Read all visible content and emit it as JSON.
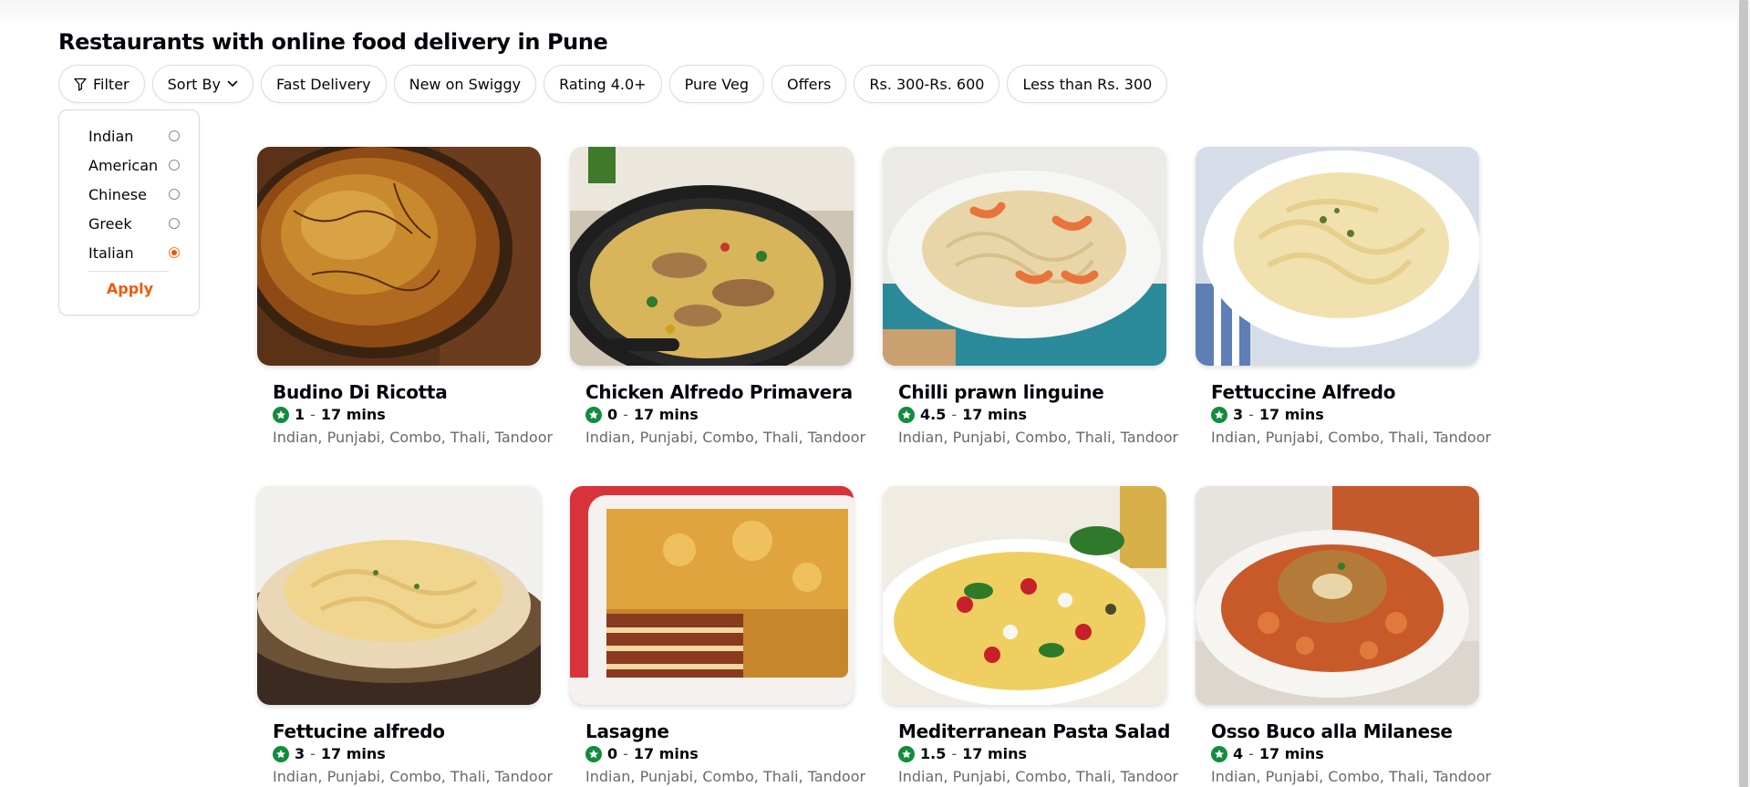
{
  "page": {
    "title": "Restaurants with online food delivery in Pune"
  },
  "filters": {
    "filter_label": "Filter",
    "sort_label": "Sort By",
    "chips": [
      "Fast Delivery",
      "New on Swiggy",
      "Rating 4.0+",
      "Pure Veg",
      "Offers",
      "Rs. 300-Rs. 600",
      "Less than Rs. 300"
    ]
  },
  "cuisine_panel": {
    "options": [
      {
        "label": "Indian",
        "selected": false
      },
      {
        "label": "American",
        "selected": false
      },
      {
        "label": "Chinese",
        "selected": false
      },
      {
        "label": "Greek",
        "selected": false
      },
      {
        "label": "Italian",
        "selected": true
      }
    ],
    "apply_label": "Apply"
  },
  "restaurants": [
    {
      "name": "Budino Di Ricotta",
      "rating": "1",
      "time": "17 mins",
      "cuisines": "Indian, Punjabi, Combo, Thali, Tandoor",
      "image": "ricotta-cake"
    },
    {
      "name": "Chicken Alfredo Primavera",
      "rating": "0",
      "time": "17 mins",
      "cuisines": "Indian, Punjabi, Combo, Thali, Tandoor",
      "image": "chicken-pasta-skillet"
    },
    {
      "name": "Chilli prawn linguine",
      "rating": "4.5",
      "time": "17 mins",
      "cuisines": "Indian, Punjabi, Combo, Thali, Tandoor",
      "image": "prawn-linguine"
    },
    {
      "name": "Fettuccine Alfredo",
      "rating": "3",
      "time": "17 mins",
      "cuisines": "Indian, Punjabi, Combo, Thali, Tandoor",
      "image": "fettuccine-plate"
    },
    {
      "name": "Fettucine alfredo",
      "rating": "3",
      "time": "17 mins",
      "cuisines": "Indian, Punjabi, Combo, Thali, Tandoor",
      "image": "fettucine-bowl"
    },
    {
      "name": "Lasagne",
      "rating": "0",
      "time": "17 mins",
      "cuisines": "Indian, Punjabi, Combo, Thali, Tandoor",
      "image": "lasagne-dish"
    },
    {
      "name": "Mediterranean Pasta Salad",
      "rating": "1.5",
      "time": "17 mins",
      "cuisines": "Indian, Punjabi, Combo, Thali, Tandoor",
      "image": "pasta-salad"
    },
    {
      "name": "Osso Buco alla Milanese",
      "rating": "4",
      "time": "17 mins",
      "cuisines": "Indian, Punjabi, Combo, Thali, Tandoor",
      "image": "osso-buco"
    }
  ],
  "meta": {
    "separator": "-"
  },
  "colors": {
    "accent": "#fc8019",
    "apply": "#f2590a",
    "rating_green": "#128c3d",
    "muted_text": "#676a6d"
  }
}
